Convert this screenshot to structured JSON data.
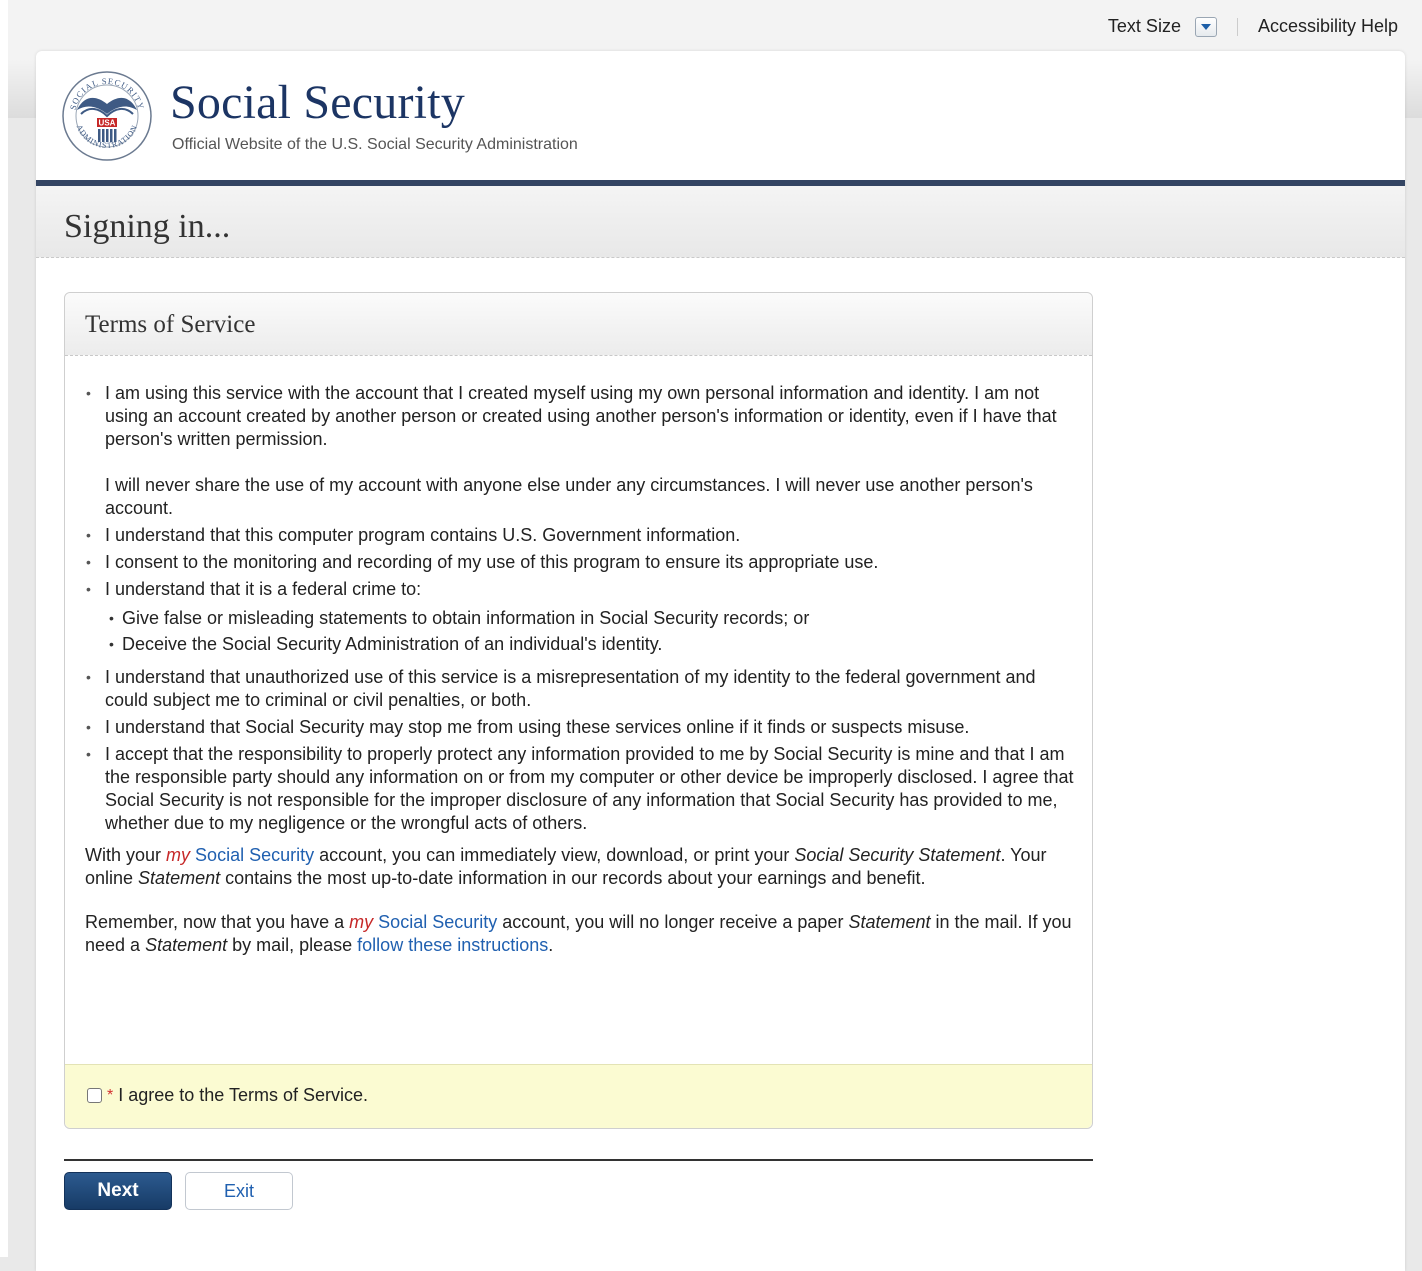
{
  "utility": {
    "text_size_label": "Text Size",
    "accessibility_help": "Accessibility Help"
  },
  "header": {
    "brand": "Social Security",
    "tagline": "Official Website of the U.S. Social Security Administration",
    "seal_icon": "ssa-seal-icon"
  },
  "page": {
    "title": "Signing in..."
  },
  "tos": {
    "title": "Terms of Service",
    "item1_p1": "I am using this service with the account that I created myself using my own personal information and identity. I am not using an account created by another person or created using another person's information or identity, even if I have that person's written permission.",
    "item1_p2": "I will never share the use of my account with anyone else under any circumstances. I will never use another person's account.",
    "item2": "I understand that this computer program contains U.S. Government information.",
    "item3": "I consent to the monitoring and recording of my use of this program to ensure its appropriate use.",
    "item4": "I understand that it is a federal crime to:",
    "item4_sub1": "Give false or misleading statements to obtain information in Social Security records; or",
    "item4_sub2": "Deceive the Social Security Administration of an individual's identity.",
    "item5": "I understand that unauthorized use of this service is a misrepresentation of my identity to the federal government and could subject me to criminal or civil penalties, or both.",
    "item6": "I understand that Social Security may stop me from using these services online if it finds or suspects misuse.",
    "item7": "I accept that the responsibility to properly protect any information provided to me by Social Security is mine and that I am the responsible party should any information on or from my computer or other device be improperly disclosed. I agree that Social Security is not responsible for the improper disclosure of any information that Social Security has provided to me, whether due to my negligence or the wrongful acts of others.",
    "para1": {
      "t1": "With your ",
      "my": "my",
      "link_ss": "Social Security",
      "t2": " account, you can immediately view, download, or print your ",
      "em1": "Social Security Statement",
      "t3": ".  Your online ",
      "em2": "Statement",
      "t4": " contains the most up-to-date information in our records about your earnings and benefit."
    },
    "para2": {
      "t1": "Remember, now that you have a ",
      "my": "my",
      "link_ss": "Social Security",
      "t2": " account, you will no longer receive a paper ",
      "em1": "Statement",
      "t3": " in the mail. If you need a ",
      "em2": "Statement",
      "t4": " by mail, please ",
      "link_follow": "follow these instructions",
      "t5": "."
    },
    "agree": {
      "required_mark": "*",
      "label": "I agree to the Terms of Service.",
      "checked": false
    }
  },
  "buttons": {
    "next": "Next",
    "exit": "Exit"
  },
  "colors": {
    "brand_navy": "#1c3564",
    "link_blue": "#2060b0",
    "my_red": "#c62828",
    "agree_bg": "#fbfbd2",
    "button_primary": "#173b66"
  }
}
